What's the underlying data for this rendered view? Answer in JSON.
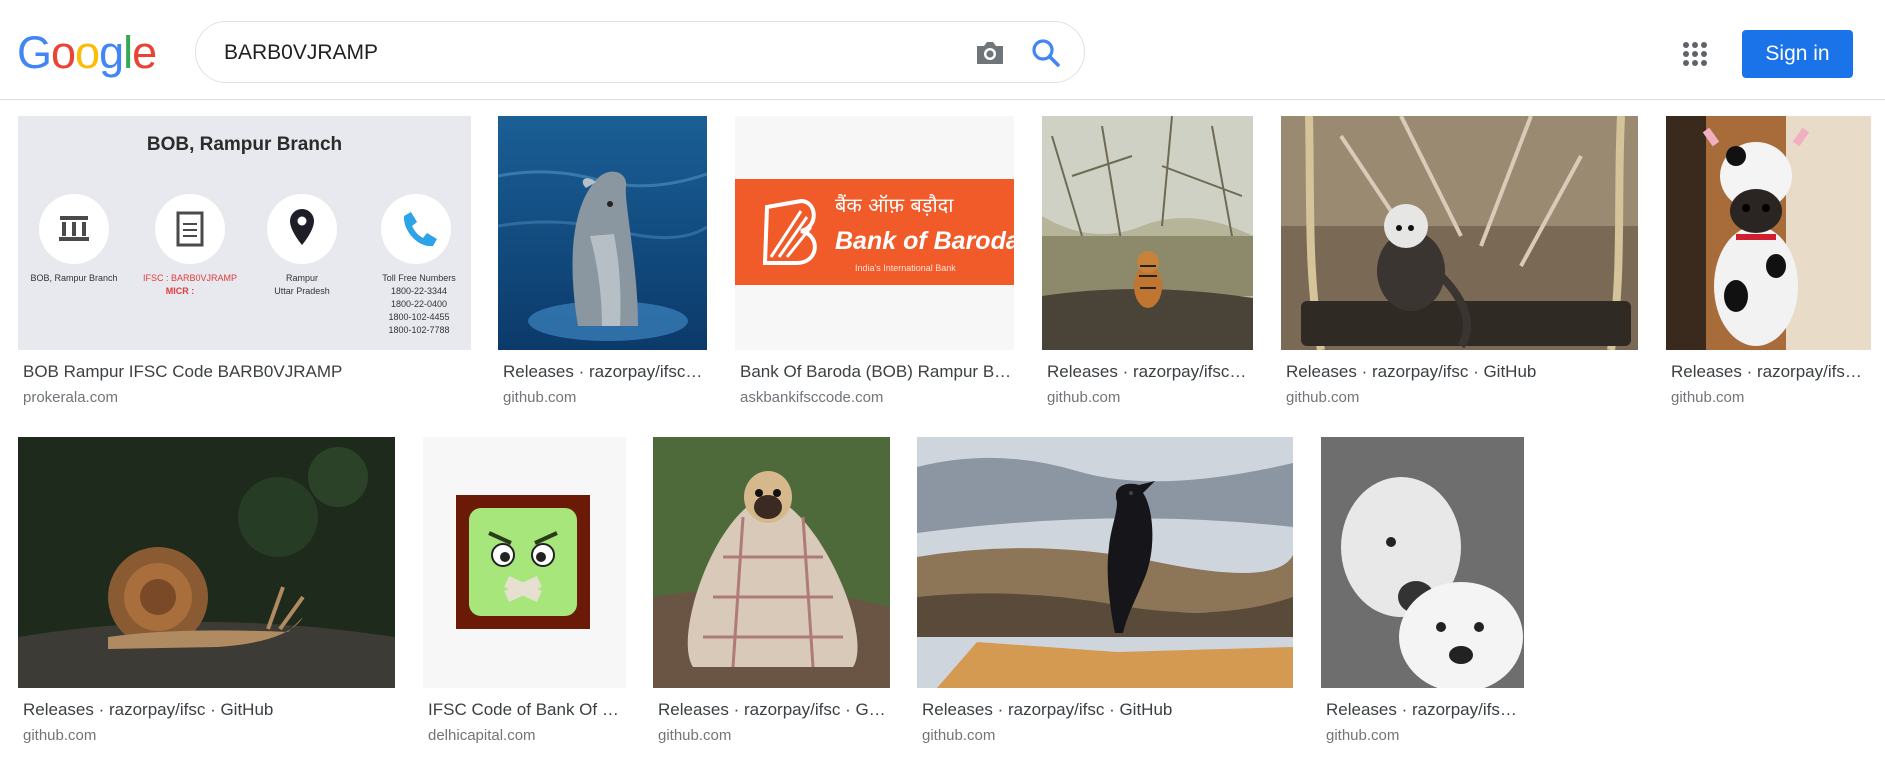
{
  "header": {
    "logo_letters": [
      "G",
      "o",
      "o",
      "g",
      "l",
      "e"
    ],
    "logo_colors": [
      "#4285F4",
      "#EA4335",
      "#FBBC05",
      "#4285F4",
      "#34A853",
      "#EA4335"
    ],
    "search_query": "BARB0VJRAMP",
    "camera_icon": "camera-icon",
    "search_icon": "search-icon",
    "apps_icon": "apps-grid-icon",
    "signin_label": "Sign in",
    "accent": "#1a73e8"
  },
  "results": [
    {
      "title": "BOB Rampur IFSC Code BARB0VJRAMP",
      "source": "prokerala.com",
      "card_heading": "BOB, Rampur Branch",
      "card_items": [
        "BOB, Rampur Branch",
        "IFSC : BARB0VJRAMP",
        "MICR :",
        "Rampur",
        "Uttar Pradesh",
        "Toll Free Numbers",
        "1800-22-3344",
        "1800-22-0400",
        "1800-102-4455",
        "1800-102-7788"
      ]
    },
    {
      "title": "Releases · razorpay/ifsc…",
      "source": "github.com",
      "image": "dolphin"
    },
    {
      "title": "Bank Of Baroda (BOB) Rampur B…",
      "source": "askbankifsccode.com",
      "logo_hindi": "बैंक ऑफ़ बड़ौदा",
      "logo_english": "Bank of Baroda",
      "logo_tagline": "India's International Bank"
    },
    {
      "title": "Releases · razorpay/ifsc…",
      "source": "github.com",
      "image": "tiger"
    },
    {
      "title": "Releases · razorpay/ifsc · GitHub",
      "source": "github.com",
      "image": "monkey-on-swing"
    },
    {
      "title": "Releases · razorpay/ifs…",
      "source": "github.com",
      "image": "pug-in-cow-costume"
    },
    {
      "title": "Releases · razorpay/ifsc · GitHub",
      "source": "github.com",
      "image": "snail"
    },
    {
      "title": "IFSC Code of Bank Of B…",
      "source": "delhicapital.com",
      "image": "angry-face-icon"
    },
    {
      "title": "Releases · razorpay/ifsc · G…",
      "source": "github.com",
      "image": "pug-in-blanket"
    },
    {
      "title": "Releases · razorpay/ifsc · GitHub",
      "source": "github.com",
      "image": "raven"
    },
    {
      "title": "Releases · razorpay/ifs…",
      "source": "github.com",
      "image": "polar-bears"
    }
  ]
}
